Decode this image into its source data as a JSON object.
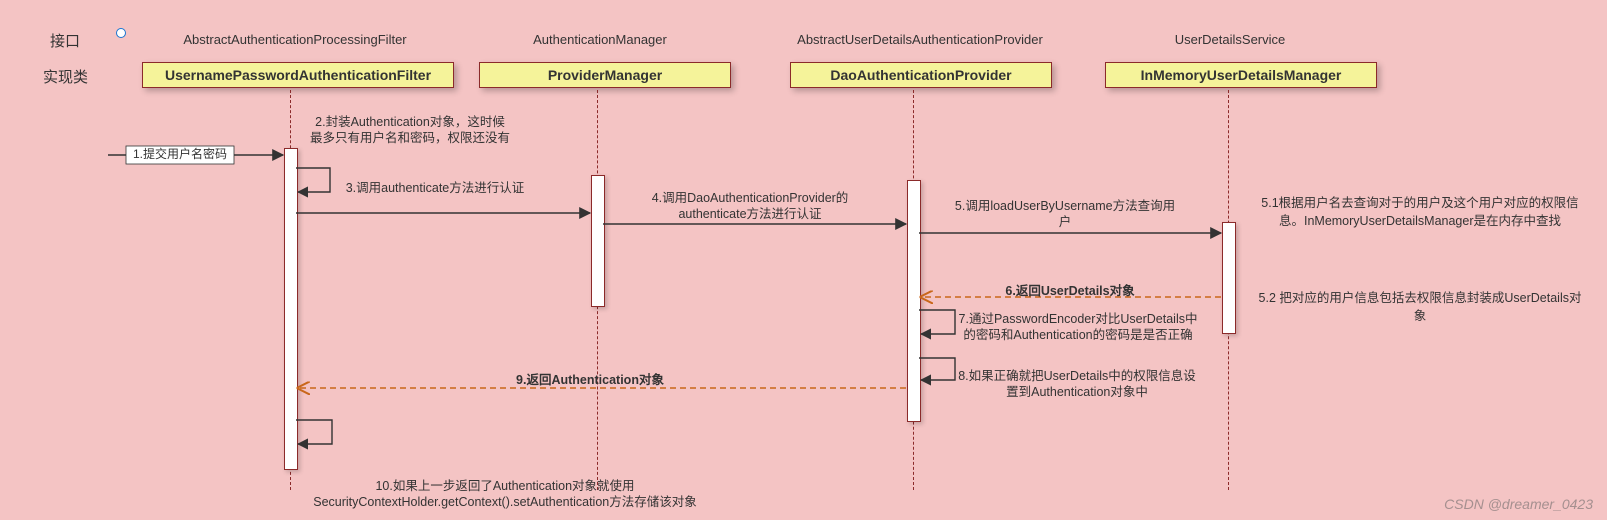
{
  "legend": {
    "iface": "接口",
    "impl": "实现类"
  },
  "lanes": {
    "l1": {
      "iface": "AbstractAuthenticationProcessingFilter",
      "impl": "UsernamePasswordAuthenticationFilter"
    },
    "l2": {
      "iface": "AuthenticationManager",
      "impl": "ProviderManager"
    },
    "l3": {
      "iface": "AbstractUserDetailsAuthenticationProvider",
      "impl": "DaoAuthenticationProvider"
    },
    "l4": {
      "iface": "UserDetailsService",
      "impl": "InMemoryUserDetailsManager"
    }
  },
  "messages": {
    "m1": "1.提交用户名密码",
    "m2": "2.封装Authentication对象，这时候最多只有用户名和密码，权限还没有",
    "m3": "3.调用authenticate方法进行认证",
    "m4": "4.调用DaoAuthenticationProvider的authenticate方法进行认证",
    "m5": "5.调用loadUserByUsername方法查询用户",
    "m6": "6.返回UserDetails对象",
    "m7": "7.通过PasswordEncoder对比UserDetails中的密码和Authentication的密码是是否正确",
    "m8": "8.如果正确就把UserDetails中的权限信息设置到Authentication对象中",
    "m9": "9.返回Authentication对象",
    "m10": "10.如果上一步返回了Authentication对象就使用SecurityContextHolder.getContext().setAuthentication方法存储该对象"
  },
  "notes": {
    "n51": "5.1根据用户名去查询对于的用户及这个用户对应的权限信息。InMemoryUserDetailsManager是在内存中查找",
    "n52": "5.2 把对应的用户信息包括去权限信息封装成UserDetails对象"
  },
  "watermark": "CSDN @dreamer_0423",
  "chart_data": {
    "type": "sequence-diagram",
    "participants": [
      {
        "interface": "AbstractAuthenticationProcessingFilter",
        "implementation": "UsernamePasswordAuthenticationFilter"
      },
      {
        "interface": "AuthenticationManager",
        "implementation": "ProviderManager"
      },
      {
        "interface": "AbstractUserDetailsAuthenticationProvider",
        "implementation": "DaoAuthenticationProvider"
      },
      {
        "interface": "UserDetailsService",
        "implementation": "InMemoryUserDetailsManager"
      }
    ],
    "messages": [
      {
        "step": 1,
        "from": "external",
        "to": "UsernamePasswordAuthenticationFilter",
        "kind": "sync",
        "text": "提交用户名密码"
      },
      {
        "step": 2,
        "from": "UsernamePasswordAuthenticationFilter",
        "to": "UsernamePasswordAuthenticationFilter",
        "kind": "self",
        "text": "封装Authentication对象，这时候最多只有用户名和密码，权限还没有"
      },
      {
        "step": 3,
        "from": "UsernamePasswordAuthenticationFilter",
        "to": "ProviderManager",
        "kind": "sync",
        "text": "调用authenticate方法进行认证"
      },
      {
        "step": 4,
        "from": "ProviderManager",
        "to": "DaoAuthenticationProvider",
        "kind": "sync",
        "text": "调用DaoAuthenticationProvider的authenticate方法进行认证"
      },
      {
        "step": 5,
        "from": "DaoAuthenticationProvider",
        "to": "InMemoryUserDetailsManager",
        "kind": "sync",
        "text": "调用loadUserByUsername方法查询用户",
        "sideNotes": [
          "5.1根据用户名去查询对于的用户及这个用户对应的权限信息。InMemoryUserDetailsManager是在内存中查找",
          "5.2 把对应的用户信息包括去权限信息封装成UserDetails对象"
        ]
      },
      {
        "step": 6,
        "from": "InMemoryUserDetailsManager",
        "to": "DaoAuthenticationProvider",
        "kind": "return",
        "text": "返回UserDetails对象"
      },
      {
        "step": 7,
        "from": "DaoAuthenticationProvider",
        "to": "DaoAuthenticationProvider",
        "kind": "self",
        "text": "通过PasswordEncoder对比UserDetails中的密码和Authentication的密码是是否正确"
      },
      {
        "step": 8,
        "from": "DaoAuthenticationProvider",
        "to": "DaoAuthenticationProvider",
        "kind": "self",
        "text": "如果正确就把UserDetails中的权限信息设置到Authentication对象中"
      },
      {
        "step": 9,
        "from": "DaoAuthenticationProvider",
        "to": "UsernamePasswordAuthenticationFilter",
        "kind": "return",
        "text": "返回Authentication对象"
      },
      {
        "step": 10,
        "from": "UsernamePasswordAuthenticationFilter",
        "to": "UsernamePasswordAuthenticationFilter",
        "kind": "self",
        "text": "如果上一步返回了Authentication对象就使用SecurityContextHolder.getContext().setAuthentication方法存储该对象"
      }
    ]
  }
}
